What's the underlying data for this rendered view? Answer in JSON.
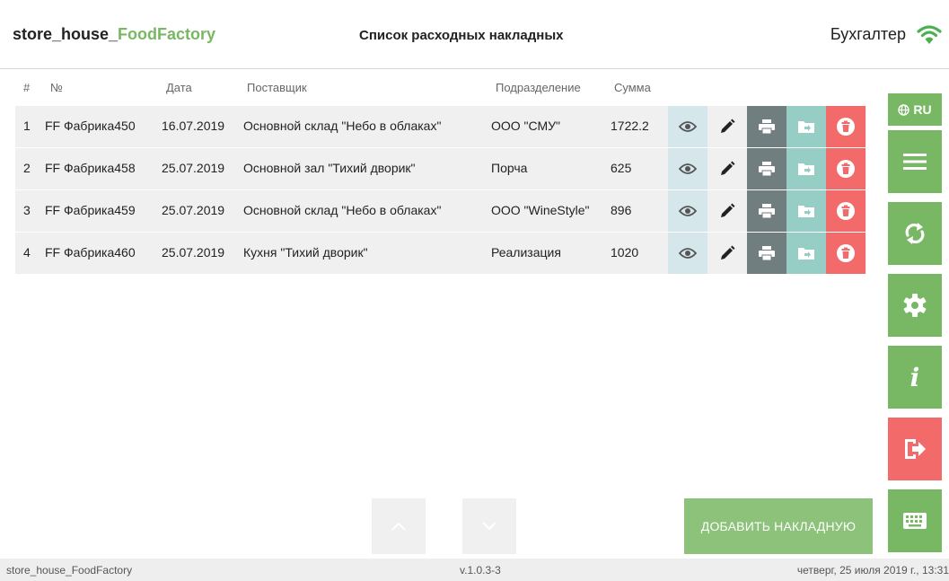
{
  "header": {
    "brand_main": "store_house_",
    "brand_accent": "FoodFactory",
    "title": "Список расходных накладных",
    "role": "Бухгалтер"
  },
  "table": {
    "columns": [
      "#",
      "№",
      "Дата",
      "Поставщик",
      "Подразделение",
      "Сумма"
    ],
    "rows": [
      {
        "idx": "1",
        "num": "FF Фабрика450",
        "date": "16.07.2019",
        "supplier": "Основной склад \"Небо в облаках\"",
        "dept": "ООО \"СМУ\"",
        "sum": "1722.2"
      },
      {
        "idx": "2",
        "num": "FF Фабрика458",
        "date": "25.07.2019",
        "supplier": "Основной зал \"Тихий дворик\"",
        "dept": "Порча",
        "sum": "625"
      },
      {
        "idx": "3",
        "num": "FF Фабрика459",
        "date": "25.07.2019",
        "supplier": "Основной склад \"Небо в облаках\"",
        "dept": "ООО \"WineStyle\"",
        "sum": "896"
      },
      {
        "idx": "4",
        "num": "FF Фабрика460",
        "date": "25.07.2019",
        "supplier": "Кухня \"Тихий дворик\"",
        "dept": "Реализация",
        "sum": "1020"
      }
    ],
    "row_actions": [
      "eye-icon",
      "pencil-icon",
      "printer-icon",
      "folder-export-icon",
      "trash-icon"
    ]
  },
  "sidebar": {
    "lang_label": "RU",
    "items": [
      "menu-icon",
      "refresh-icon",
      "gear-icon",
      "info-icon",
      "logout-icon",
      "keyboard-icon"
    ]
  },
  "actions": {
    "add_label": "ДОБАВИТЬ НАКЛАДНУЮ"
  },
  "footer": {
    "app": "store_house_FoodFactory",
    "version": "v.1.0.3-3",
    "datetime": "четверг, 25 июля 2019 г., 13:31"
  },
  "colors": {
    "accent": "#78b764",
    "danger": "#f26a6a",
    "print": "#717e80",
    "export": "#96cdc5",
    "view": "#d6e7ec"
  }
}
